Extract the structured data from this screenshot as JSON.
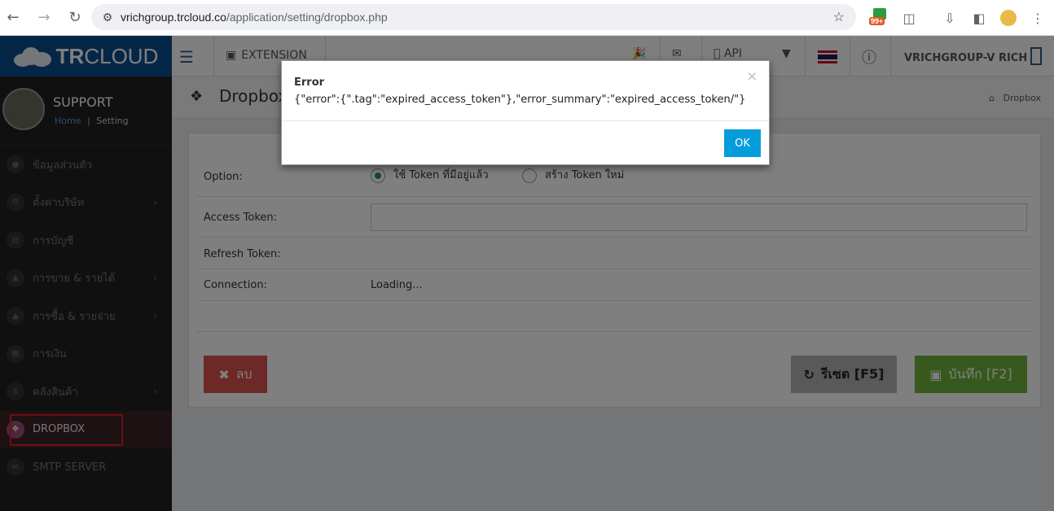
{
  "browser": {
    "host": "vrichgroup.trcloud.co",
    "path": "/application/setting/dropbox.php",
    "badge": "99+"
  },
  "topbar": {
    "logo_bold": "TR",
    "logo_rest": "CLOUD",
    "extension_label": "EXTENSION",
    "api_label": "API",
    "user_label": "VRICHGROUP-V RICH"
  },
  "sidebar": {
    "profile_name": "SUPPORT",
    "crumb_home": "Home",
    "crumb_sep": "|",
    "crumb_current": "Setting",
    "items": [
      {
        "label": "ข้อมูลส่วนตัว",
        "icon": "user-icon",
        "chevron": false
      },
      {
        "label": "ตั้งค่าบริษัท",
        "icon": "gear-icon",
        "chevron": true
      },
      {
        "label": "การบัญชี",
        "icon": "book-icon",
        "chevron": false
      },
      {
        "label": "การขาย & รายได้",
        "icon": "cart-icon",
        "chevron": true
      },
      {
        "label": "การซื้อ & รายจ่าย",
        "icon": "cart-icon",
        "chevron": true
      },
      {
        "label": "การเงิน",
        "icon": "calendar-icon",
        "chevron": false
      },
      {
        "label": "คลังสินค้า",
        "icon": "dollar-icon",
        "chevron": true
      },
      {
        "label": "DROPBOX",
        "icon": "dropbox-icon",
        "chevron": false
      },
      {
        "label": "SMTP SERVER",
        "icon": "mail-icon",
        "chevron": false
      }
    ]
  },
  "page": {
    "title": "Dropbox",
    "breadcrumb": "Dropbox"
  },
  "form": {
    "option_label": "Option:",
    "option_use_existing": "ใช้ Token ที่มีอยู่แล้ว",
    "option_create_new": "สร้าง Token ใหม่",
    "access_token_label": "Access Token:",
    "access_token_value": "",
    "refresh_token_label": "Refresh Token:",
    "connection_label": "Connection:",
    "connection_value": "Loading..."
  },
  "buttons": {
    "delete": "ลบ",
    "reset": "รีเซต [F5]",
    "save": "บันทึก [F2]"
  },
  "modal": {
    "title": "Error",
    "message": "{\"error\":{\".tag\":\"expired_access_token\"},\"error_summary\":\"expired_access_token/\"}",
    "close": "×",
    "ok": "OK"
  }
}
